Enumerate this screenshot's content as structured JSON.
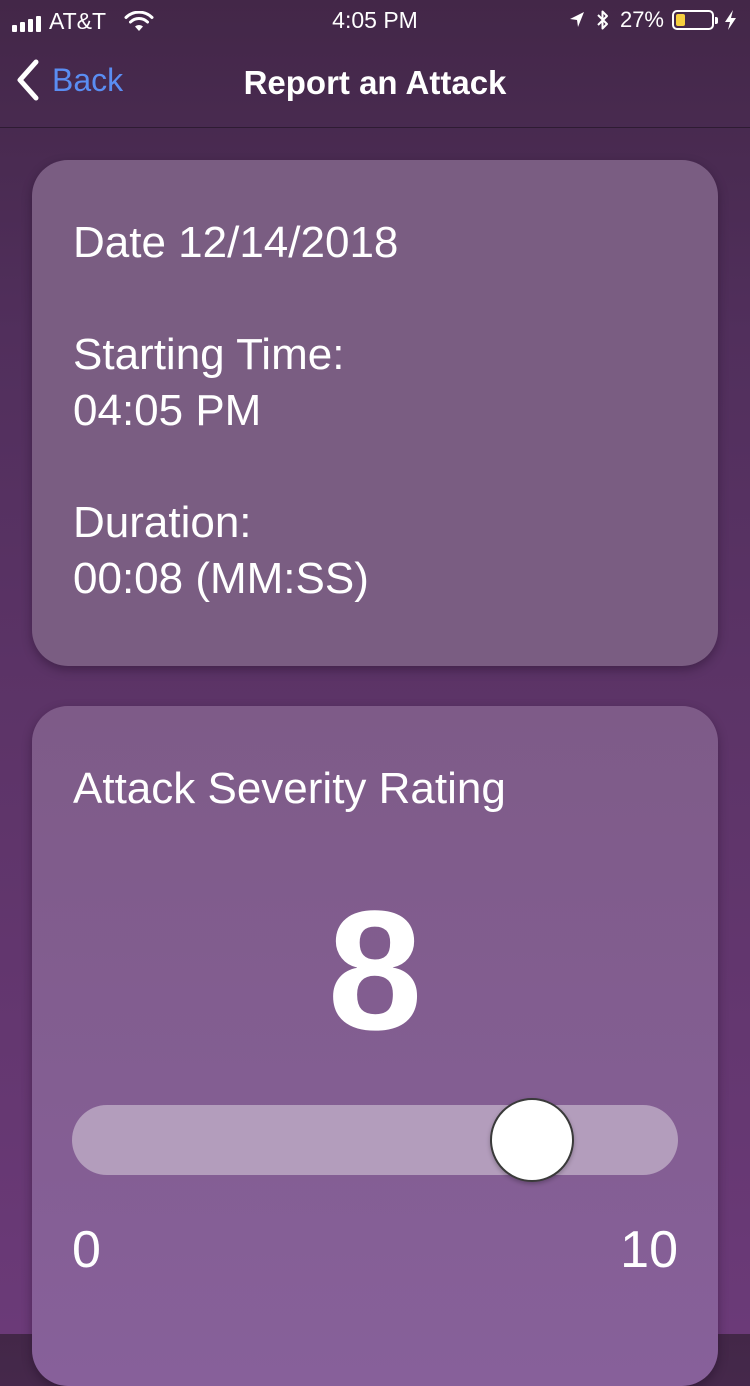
{
  "status_bar": {
    "carrier": "AT&T",
    "time": "4:05 PM",
    "battery_percent": "27%",
    "battery_level": 0.27,
    "battery_fill_color": "#f6cf3e",
    "icons": [
      "signal-icon",
      "wifi-icon",
      "location-icon",
      "bluetooth-icon",
      "battery-icon",
      "charging-icon"
    ]
  },
  "nav": {
    "back_label": "Back",
    "title": "Report an Attack",
    "back_color": "#5a8df2"
  },
  "info_card": {
    "date": "Date 12/14/2018",
    "starting_time_label": "Starting Time:",
    "starting_time_value": "04:05 PM",
    "duration_label": "Duration:",
    "duration_value": "00:08 (MM:SS)"
  },
  "severity_card": {
    "title": "Attack Severity Rating",
    "value": "8",
    "slider": {
      "min": 0,
      "max": 10,
      "value": 8,
      "min_label": "0",
      "max_label": "10"
    }
  }
}
